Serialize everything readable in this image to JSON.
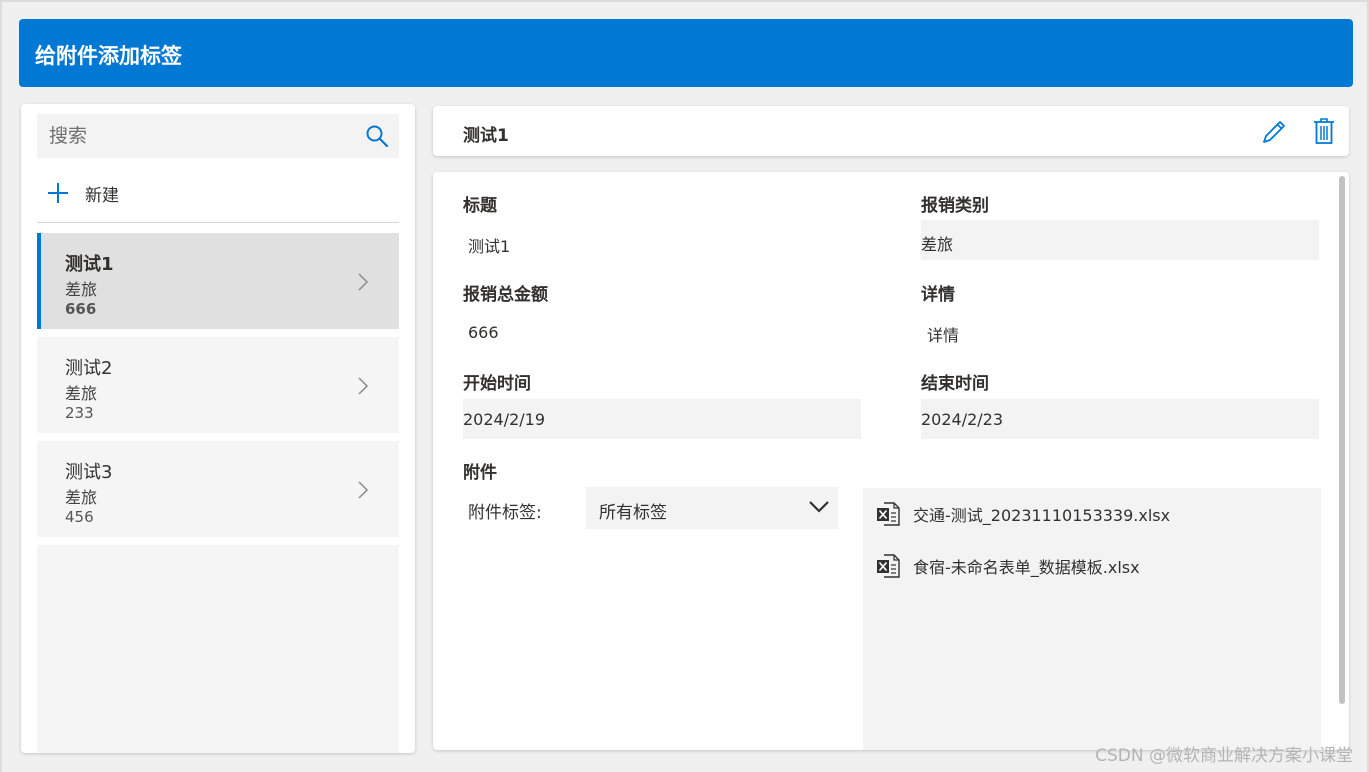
{
  "app": {
    "title": "给附件添加标签"
  },
  "sidebar": {
    "search_placeholder": "搜索",
    "search_icon": "search-icon",
    "new_label": "新建",
    "items": [
      {
        "title": "测试1",
        "category": "差旅",
        "amount": "666",
        "selected": true
      },
      {
        "title": "测试2",
        "category": "差旅",
        "amount": "233",
        "selected": false
      },
      {
        "title": "测试3",
        "category": "差旅",
        "amount": "456",
        "selected": false
      }
    ]
  },
  "detail": {
    "record_title": "测试1",
    "edit_icon": "pencil-icon",
    "delete_icon": "trash-icon",
    "fields": {
      "title_label": "标题",
      "title_value": "测试1",
      "category_label": "报销类别",
      "category_value": "差旅",
      "amount_label": "报销总金额",
      "amount_value": "666",
      "details_label": "详情",
      "details_value": "详情",
      "start_label": "开始时间",
      "start_value": "2024/2/19",
      "end_label": "结束时间",
      "end_value": "2024/2/23"
    },
    "attachments": {
      "section_label": "附件",
      "tag_label": "附件标签:",
      "tag_selected": "所有标签",
      "files": [
        {
          "name": "交通-测试_20231110153339.xlsx",
          "icon": "excel-file-icon"
        },
        {
          "name": "食宿-未命名表单_数据模板.xlsx",
          "icon": "excel-file-icon"
        }
      ]
    }
  },
  "watermark": "CSDN @微软商业解决方案小课堂",
  "colors": {
    "accent": "#0078d4",
    "panel": "#f3f3f3",
    "selected": "#e0e0e0"
  }
}
